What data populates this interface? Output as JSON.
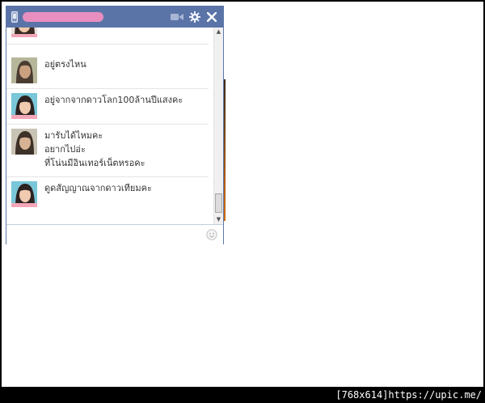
{
  "chat": {
    "messages": [
      {
        "text": ""
      },
      {
        "text": "อยู่ตรงไหน"
      },
      {
        "text": "อยู่จากจากดาวโลก100ล้านปีแสงคะ"
      },
      {
        "lines": [
          "มารับได้ไหมคะ",
          "อยากไปอ่ะ",
          "ที่โน่นมีอินเทอร์เน็ตหรอคะ"
        ]
      },
      {
        "text": "ดูดสัญญาณจากดาวเทียมคะ"
      }
    ],
    "composer_placeholder": ""
  },
  "icons": {
    "phone": "mobile-phone-icon",
    "video": "video-camera-icon",
    "settings": "gear-icon",
    "close": "close-icon",
    "emoji": "smiley-icon"
  },
  "colors": {
    "titlebar": "#5b74a8",
    "name_blur": "#e88fbf",
    "page_background": "#ffffff",
    "frame": "#000000"
  },
  "watermark": {
    "size": "[768x614]",
    "url": "https://upic.me/"
  }
}
